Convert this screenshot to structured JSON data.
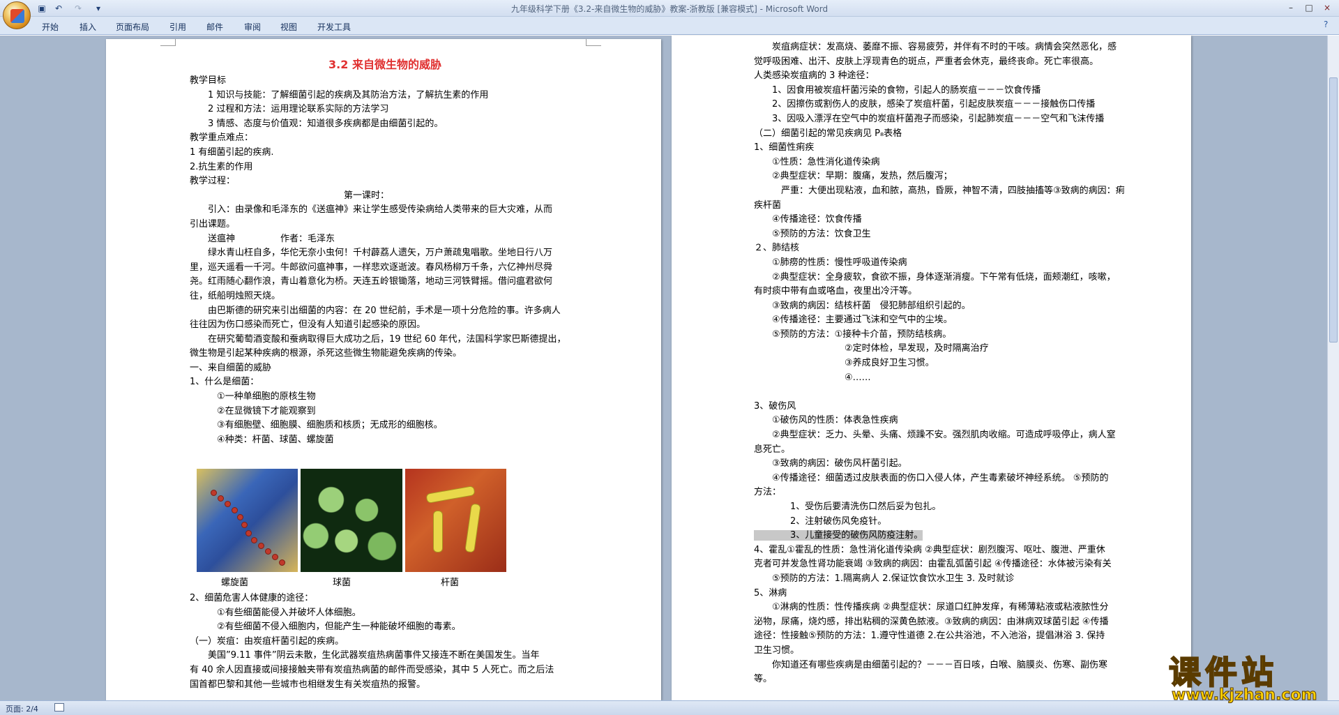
{
  "window": {
    "title": "九年级科学下册《3.2-来自微生物的威胁》教案-浙教版 [兼容模式] - Microsoft Word",
    "controls": [
      "–",
      "□",
      "×"
    ]
  },
  "ribbon": {
    "tabs": [
      "开始",
      "插入",
      "页面布局",
      "引用",
      "邮件",
      "审阅",
      "视图",
      "开发工具"
    ]
  },
  "status": {
    "page": "页面: 2/4"
  },
  "watermark": {
    "text": "课件站",
    "url": "www.kjzhan.com"
  },
  "left_page": {
    "title": "3.2 来自微生物的威胁",
    "lines_top": [
      "教学目标",
      "　　1 知识与技能：了解细菌引起的疾病及其防治方法，了解抗生素的作用",
      "　　2 过程和方法：运用理论联系实际的方法学习",
      "　　3 情感、态度与价值观：知道很多疾病都是由细菌引起的。",
      "教学重点难点：",
      "1 有细菌引起的疾病.",
      "2.抗生素的作用",
      "教学过程：",
      "　　　　　　　　　　　　　　　　　第一课时：",
      "　　引入：由录像和毛泽东的《送瘟神》来让学生感受传染病给人类带来的巨大灾难，从而",
      "引出课题。",
      "　　送瘟神　　　　　作者：毛泽东",
      "　　绿水青山枉自多，华佗无奈小虫何！千村薜荔人遗矢，万户萧疏鬼唱歌。坐地日行八万",
      "里，巡天遥看一千河。牛郎欲问瘟神事，一样悲欢逐逝波。春风杨柳万千条，六亿神州尽舜",
      "尧。红雨随心翻作浪，青山着意化为桥。天连五岭银锄落，地动三河铁臂摇。借问瘟君欲何",
      "往，纸船明烛照天烧。",
      "　　由巴斯德的研究来引出细菌的内容：在 20 世纪前，手术是一项十分危险的事。许多病人",
      "往往因为伤口感染而死亡，但没有人知道引起感染的原因。",
      "　　在研究葡萄酒变酸和蚕病取得巨大成功之后，19 世纪 60 年代，法国科学家巴斯德提出，",
      "微生物是引起某种疾病的根源，杀死这些微生物能避免疾病的传染。",
      "一、来自细菌的威胁",
      "1、什么是细菌：",
      "　　　①一种单细胞的原核生物",
      "　　　②在显微镜下才能观察到",
      "　　　③有细胞壁、细胞膜、细胞质和核质；无成形的细胞核。",
      "　　　④种类：杆菌、球菌、螺旋菌"
    ],
    "figure_captions": [
      "螺旋菌",
      "球菌",
      "杆菌"
    ],
    "lines_bottom": [
      "2、细菌危害人体健康的途径：",
      "　　　①有些细菌能侵入并破坏人体细胞。",
      "　　　②有些细菌不侵入细胞内，但能产生一种能破坏细胞的毒素。",
      "（一）炭疽：由炭疽杆菌引起的疾病。",
      "　　美国”9.11 事件”阴云未散，生化武器炭疽热病菌事件又接连不断在美国发生。当年",
      "有 40 余人因直接或间接接触夹带有炭疽热病菌的邮件而受感染，其中 5 人死亡。而之后法",
      "国首都巴黎和其他一些城市也相继发生有关炭疽热的报警。"
    ]
  },
  "right_page": {
    "lines": [
      "　　炭疽病症状：发高烧、萎靡不振、容易疲劳，并伴有不时的干咳。病情会突然恶化，感",
      "觉呼吸困难、出汗、皮肤上浮现青色的斑点，严重者会休克，最终丧命。死亡率很高。",
      "人类感染炭疽病的 3 种途径：",
      "　　1、因食用被炭疽杆菌污染的食物，引起人的肠炭疽－－－饮食传播",
      "　　2、因擦伤或割伤人的皮肤，感染了炭疽杆菌，引起皮肤炭疽－－－接触伤口传播",
      "　　3、因吸入漂浮在空气中的炭疽杆菌孢子而感染，引起肺炭疽－－－空气和飞沫传播",
      "（二）细菌引起的常见疾病见 P₈表格",
      "1、细菌性痢疾",
      "　　①性质：急性消化道传染病",
      "　　②典型症状：早期：腹痛，发热，然后腹泻；",
      "　　　严重：大便出现粘液，血和脓，高热，昏厥，神智不清，四肢抽搐等③致病的病因：痢",
      "疾杆菌",
      "　　④传播途径：饮食传播",
      "　　⑤预防的方法：饮食卫生",
      "２、肺结核",
      "　　①肺痨的性质：慢性呼吸道传染病",
      "　　②典型症状：全身疲软，食欲不振，身体逐渐消瘦。下午常有低烧，面颊潮红，咳嗽，",
      "有时痰中带有血或咯血，夜里出冷汗等。",
      "　　③致病的病因：结核杆菌　侵犯肺部组织引起的。",
      "　　④传播途径：主要通过飞沫和空气中的尘埃。",
      "　　⑤预防的方法：①接种卡介苗，预防结核病。",
      "　　　　　　　　　　②定时体检，早发现，及时隔离治疗",
      "　　　　　　　　　　③养成良好卫生习惯。",
      "　　　　　　　　　　④……",
      "",
      "3、破伤风",
      "　　①破伤风的性质：体表急性疾病",
      "　　②典型症状：乏力、头晕、头痛、烦躁不安。强烈肌肉收缩。可造成呼吸停止，病人窒",
      "息死亡。",
      "　　③致病的病因：破伤风杆菌引起。",
      "　　④传播途径：细菌透过皮肤表面的伤口入侵人体，产生毒素破坏神经系统。 ⑤预防的",
      "方法：",
      "　　　　1、受伤后要清洗伤口然后妥为包扎。",
      "　　　　2、注射破伤风免疫针。",
      "　　　　3、儿童接受的破伤风防疫注射。",
      "4、霍乱①霍乱的性质：急性消化道传染病 ②典型症状：剧烈腹泻、呕吐、腹泄、严重休",
      "克者可并发急性肾功能衰竭 ③致病的病因：由霍乱弧菌引起 ④传播途径：水体被污染有关",
      "　　⑤预防的方法：1.隔离病人 2.保证饮食饮水卫生 3. 及时就诊",
      "5、淋病",
      "　　①淋病的性质：性传播疾病 ②典型症状：尿道口红肿发痒，有稀薄粘液或粘液脓性分",
      "泌物，尿痛，烧灼感，排出粘稠的深黄色脓液。③致病的病因：由淋病双球菌引起 ④传播",
      "途径：性接触⑤预防的方法：1.遵守性道德 2.在公共浴池，不入池浴，提倡淋浴 3. 保持",
      "卫生习惯。",
      "　　你知道还有哪些疾病是由细菌引起的？－－－百日咳，白喉、脑膜炎、伤寒、副伤寒",
      "等。"
    ]
  }
}
